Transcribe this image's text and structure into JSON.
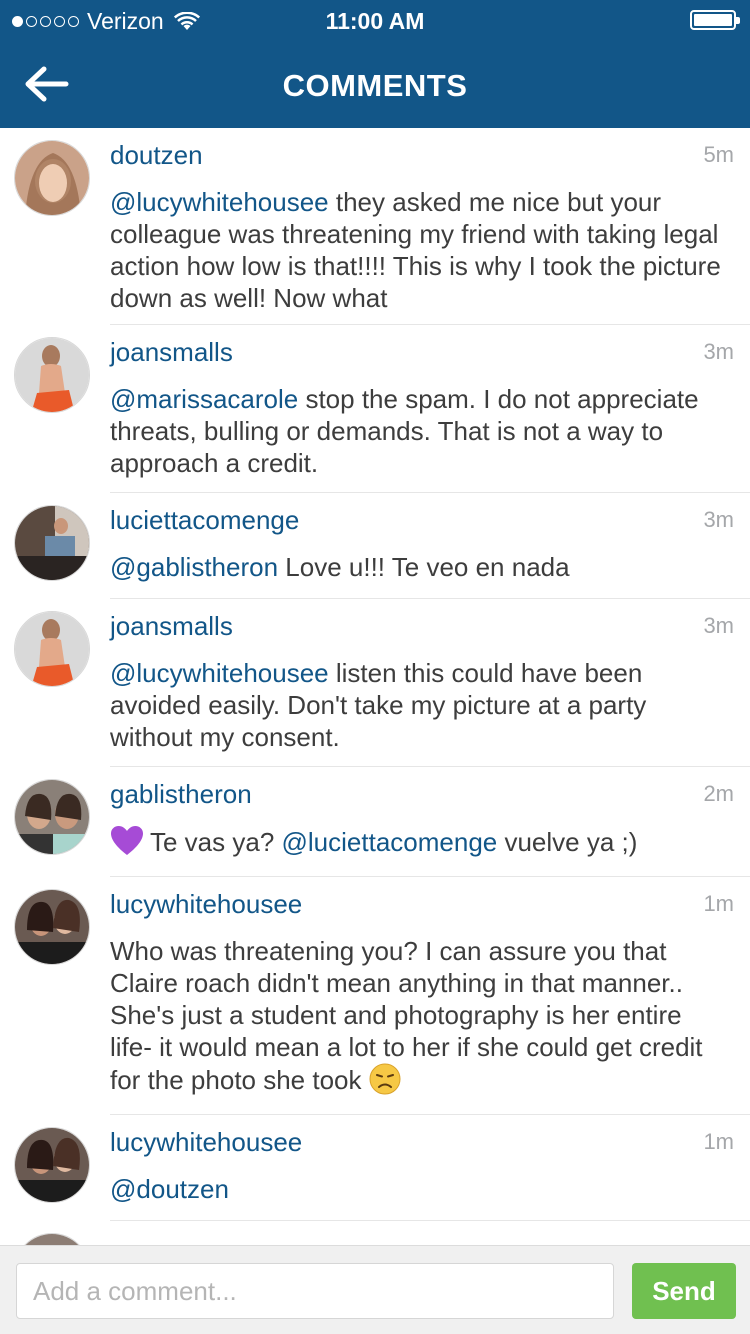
{
  "status_bar": {
    "signal_dots": 5,
    "signal_filled": 1,
    "carrier": "Verizon",
    "time": "11:00 AM",
    "battery_level": 0.95
  },
  "nav": {
    "back_icon": "arrow-left-icon",
    "title": "COMMENTS"
  },
  "colors": {
    "brand": "#125688",
    "send": "#70c050"
  },
  "comments": [
    {
      "username": "doutzen",
      "age": "5m",
      "mention": "@lucywhitehousee",
      "text": " they asked me nice but your colleague was threatening my friend with taking legal action how low is that!!!! This is why I took the picture down as well! Now what"
    },
    {
      "username": "joansmalls",
      "age": "3m",
      "mention": "@marissacarole",
      "text": " stop the spam. I do not appreciate threats, bulling or demands. That is not a way to approach a credit."
    },
    {
      "username": "luciettacomenge",
      "age": "3m",
      "mention": "@gablistheron",
      "text": " Love u!!! Te veo en nada"
    },
    {
      "username": "joansmalls",
      "age": "3m",
      "mention": "@lucywhitehousee",
      "text": " listen this could have been avoided easily. Don't take my picture at a party without my consent."
    },
    {
      "username": "gablistheron",
      "age": "2m",
      "emoji": "purple-heart-icon",
      "text_before": "Te vas ya? ",
      "mention": "@luciettacomenge",
      "text": " vuelve ya ;)"
    },
    {
      "username": "lucywhitehousee",
      "age": "1m",
      "text": "Who was threatening you? I can assure you that Claire roach didn't mean anything in that manner.. She's just a student and photography is her entire life- it would mean a lot to her if she could get credit for the photo she took ",
      "emoji_after": "disappointed-face-icon"
    },
    {
      "username": "lucywhitehousee",
      "age": "1m",
      "mention": "@doutzen",
      "text": ""
    }
  ],
  "composer": {
    "placeholder": "Add a comment...",
    "send_label": "Send"
  }
}
